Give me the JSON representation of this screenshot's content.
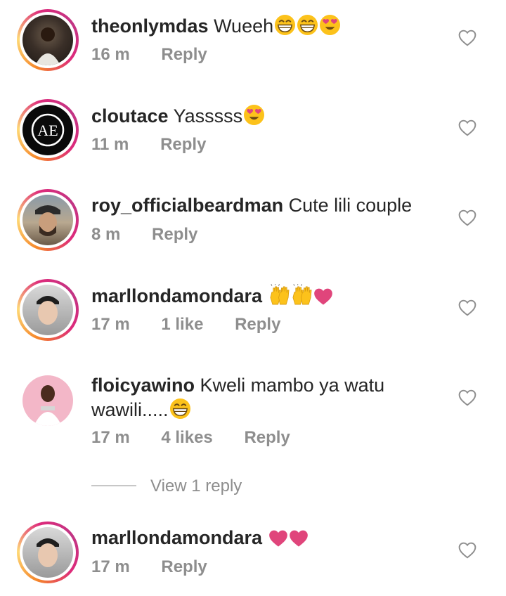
{
  "comments": [
    {
      "username": "theonlymdas",
      "text": "Wueeh",
      "time": "16 m",
      "likes": "",
      "reply": "Reply"
    },
    {
      "username": "cloutace",
      "text": "Yasssss",
      "time": "11 m",
      "likes": "",
      "reply": "Reply"
    },
    {
      "username": "roy_officialbeardman",
      "text": "Cute lili couple",
      "time": "8 m",
      "likes": "",
      "reply": "Reply"
    },
    {
      "username": "marllondamondara",
      "text": "",
      "time": "17 m",
      "likes": "1 like",
      "reply": "Reply"
    },
    {
      "username": "floicyawino",
      "text": "Kweli mambo ya watu",
      "text2": "wawili.....",
      "time": "17 m",
      "likes": "4 likes",
      "reply": "Reply"
    },
    {
      "username": "marllondamondara",
      "text": "",
      "time": "17 m",
      "likes": "",
      "reply": "Reply"
    }
  ],
  "view_replies": "View 1 reply",
  "colors": {
    "text": "#262626",
    "muted": "#8e8e8e",
    "heart": "#e0457b",
    "emoji": "#fcc21b"
  },
  "icons": {
    "like": "heart-outline-icon",
    "emoji_grin": "grinning-emoji",
    "emoji_hearts": "heart-eyes-emoji",
    "emoji_hands": "raised-hands-emoji",
    "red_heart": "red-heart-icon"
  }
}
